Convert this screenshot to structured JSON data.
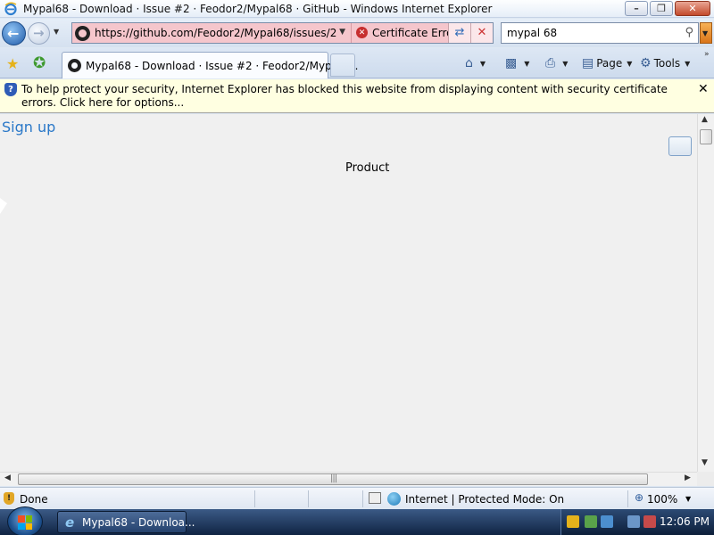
{
  "window": {
    "title": "Mypal68 - Download · Issue #2 · Feodor2/Mypal68 · GitHub - Windows Internet Explorer"
  },
  "address_bar": {
    "url": "https://github.com/Feodor2/Mypal68/issues/2",
    "certificate_label": "Certificate Error"
  },
  "search": {
    "value": "mypal 68"
  },
  "tabs": [
    {
      "label": "Mypal68 - Download · Issue #2 · Feodor2/Mypal6..."
    }
  ],
  "command_bar": {
    "page_label": "Page",
    "tools_label": "Tools"
  },
  "info_bar": {
    "message": "To help protect your security, Internet Explorer has blocked this website from displaying content with security certificate errors. Click here for options..."
  },
  "content": {
    "signup_link": "Sign up",
    "product_text": "Product"
  },
  "status_bar": {
    "status": "Done",
    "zone": "Internet | Protected Mode: On",
    "zoom": "100%"
  },
  "taskbar": {
    "task_label": "Mypal68 - Downloa...",
    "clock": "12:06 PM"
  },
  "colors": {
    "address_error_bg": "#f5c6cc",
    "info_bar_bg": "#ffffe1",
    "link": "#2a78c8",
    "taskbar": "#1b3358"
  }
}
